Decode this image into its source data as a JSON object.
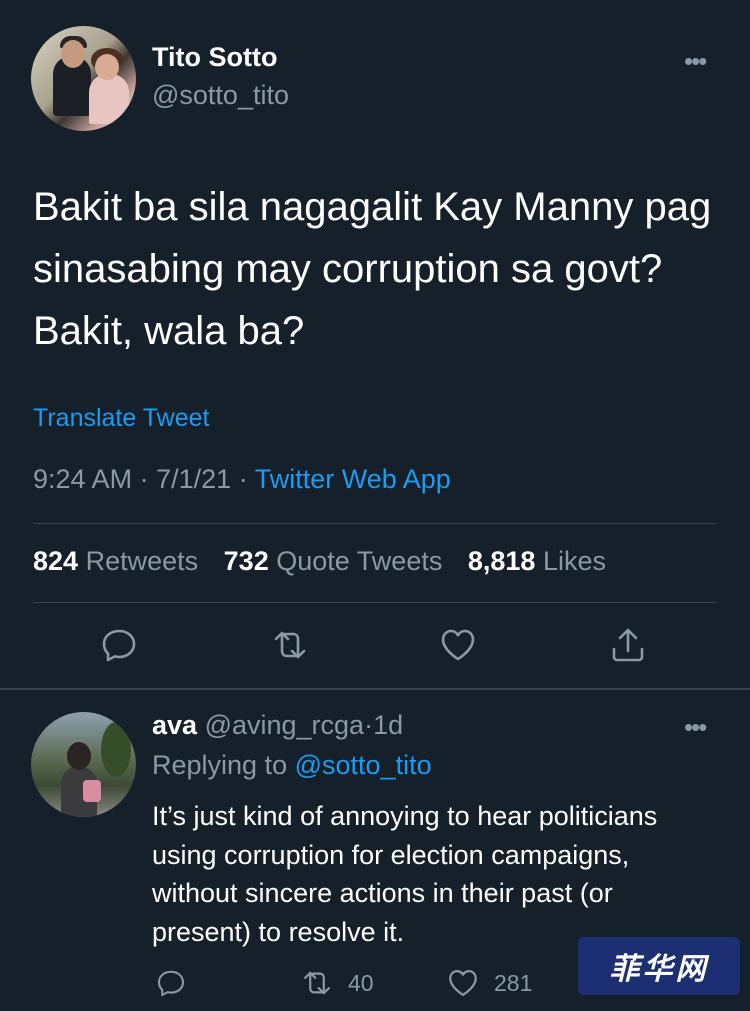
{
  "tweet": {
    "author_name": "Tito Sotto",
    "author_handle": "@sotto_tito",
    "more_label": "•••",
    "text": "Bakit ba sila nagagalit Kay Manny pag sinasabing may corruption sa govt? Bakit, wala ba?",
    "translate_label": "Translate Tweet",
    "time": "9:24 AM",
    "date": "7/1/21",
    "dot": "·",
    "source_app": "Twitter Web App",
    "stats": {
      "retweets_count": "824",
      "retweets_label": "Retweets",
      "quotes_count": "732",
      "quotes_label": "Quote Tweets",
      "likes_count": "8,818",
      "likes_label": "Likes"
    },
    "action_icons": [
      "reply-icon",
      "retweet-icon",
      "like-icon",
      "share-icon"
    ]
  },
  "reply": {
    "name": "ava",
    "handle": "@aving_rcga",
    "age": "1d",
    "dot": "·",
    "more_label": "•••",
    "replying_prefix": "Replying to",
    "replying_mention": "@sotto_tito",
    "text": "It’s just kind of annoying to hear politicians using corruption for election campaigns, without sincere actions in their past (or present) to resolve it.",
    "retweet_count": "40",
    "like_count": "281"
  },
  "watermark": {
    "text": "菲华网"
  },
  "colors": {
    "background": "#15202b",
    "accent": "#1d9bf0",
    "muted": "#8b98a5",
    "divider": "#38444d"
  }
}
